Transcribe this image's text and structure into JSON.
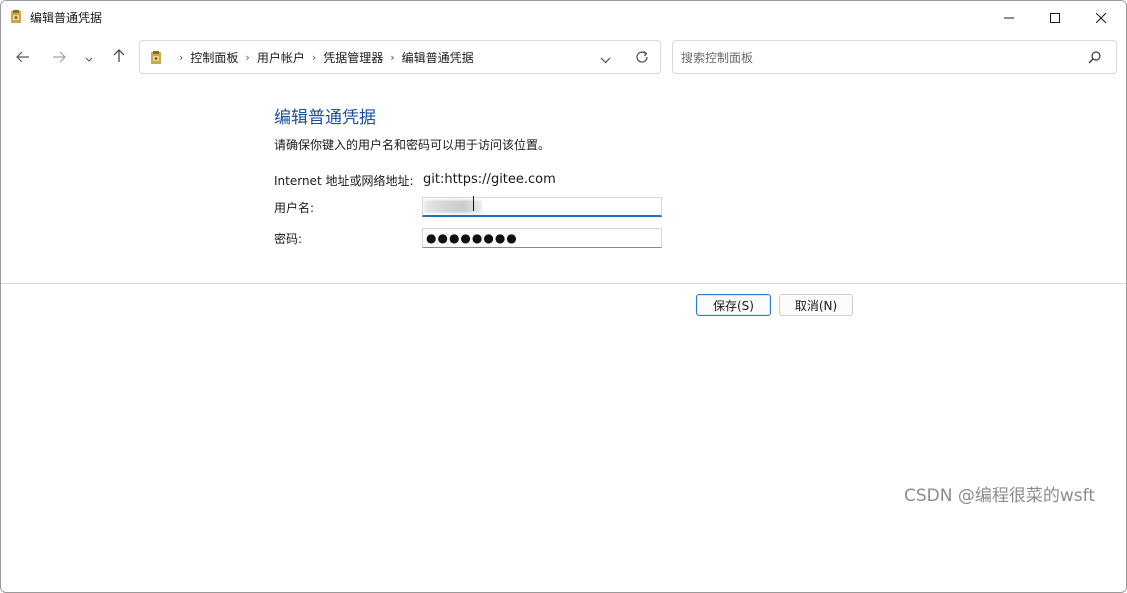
{
  "window": {
    "title": "编辑普通凭据",
    "icons": [
      "credential-manager-icon",
      "minimize-icon",
      "maximize-icon",
      "close-icon"
    ]
  },
  "nav": {
    "icons": [
      "back-arrow-icon",
      "forward-arrow-icon",
      "chevron-down-icon",
      "up-arrow-icon"
    ],
    "breadcrumbs": [
      "控制面板",
      "用户帐户",
      "凭据管理器",
      "编辑普通凭据"
    ],
    "search_placeholder": "搜索控制面板"
  },
  "form": {
    "heading": "编辑普通凭据",
    "instruction": "请确保你键入的用户名和密码可以用于访问该位置。",
    "internet_label": "Internet 地址或网络地址:",
    "internet_value": "git:https://gitee.com",
    "username_label": "用户名:",
    "password_label": "密码:",
    "password_mask": "●●●●●●●●"
  },
  "buttons": {
    "save": "保存(S)",
    "cancel": "取消(N)"
  },
  "watermark": "CSDN @编程很菜的wsft",
  "colors": {
    "heading": "#1e50a2",
    "focus_accent": "#1f6fc4"
  }
}
